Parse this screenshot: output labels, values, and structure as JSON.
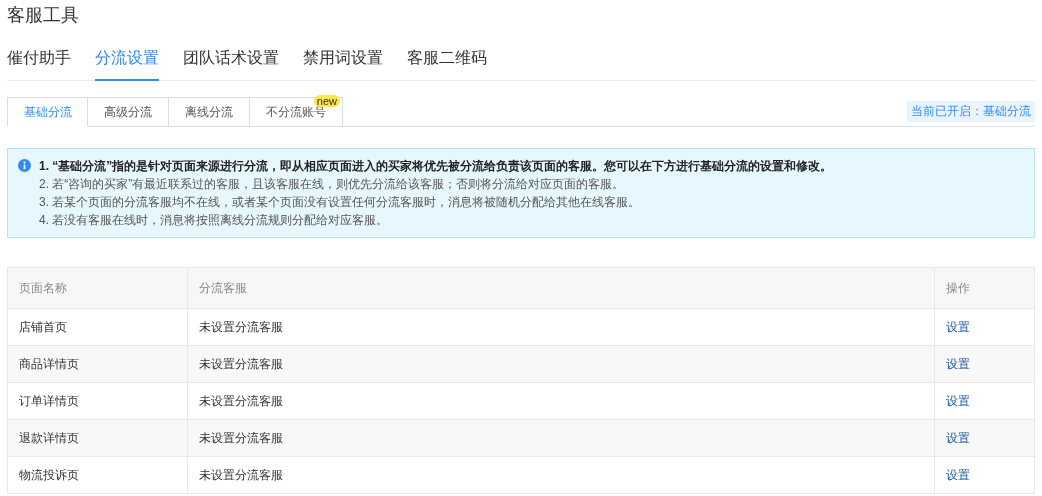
{
  "page_title": "客服工具",
  "tabs": [
    {
      "label": "催付助手",
      "selected": false
    },
    {
      "label": "分流设置",
      "selected": true
    },
    {
      "label": "团队话术设置",
      "selected": false
    },
    {
      "label": "禁用词设置",
      "selected": false
    },
    {
      "label": "客服二维码",
      "selected": false
    }
  ],
  "sub_tabs": [
    {
      "label": "基础分流",
      "selected": true
    },
    {
      "label": "高级分流",
      "selected": false
    },
    {
      "label": "离线分流",
      "selected": false
    },
    {
      "label": "不分流账号",
      "selected": false,
      "badge": "new"
    }
  ],
  "status_tag": "当前已开启：基础分流",
  "notice": [
    {
      "text": "1. “基础分流”指的是针对页面来源进行分流，即从相应页面进入的买家将优先被分流给负责该页面的客服。您可以在下方进行基础分流的设置和修改。",
      "bold": true
    },
    {
      "text": "2. 若“咨询的买家”有最近联系过的客服，且该客服在线，则优先分流给该客服；否则将分流给对应页面的客服。",
      "bold": false
    },
    {
      "text": "3. 若某个页面的分流客服均不在线，或者某个页面没有设置任何分流客服时，消息将被随机分配给其他在线客服。",
      "bold": false
    },
    {
      "text": "4. 若没有客服在线时，消息将按照离线分流规则分配给对应客服。",
      "bold": false
    }
  ],
  "table": {
    "columns": [
      "页面名称",
      "分流客服",
      "操作"
    ],
    "rows": [
      {
        "page": "店铺首页",
        "agent": "未设置分流客服",
        "action": "设置"
      },
      {
        "page": "商品详情页",
        "agent": "未设置分流客服",
        "action": "设置"
      },
      {
        "page": "订单详情页",
        "agent": "未设置分流客服",
        "action": "设置"
      },
      {
        "page": "退款详情页",
        "agent": "未设置分流客服",
        "action": "设置"
      },
      {
        "page": "物流投诉页",
        "agent": "未设置分流客服",
        "action": "设置"
      }
    ]
  }
}
